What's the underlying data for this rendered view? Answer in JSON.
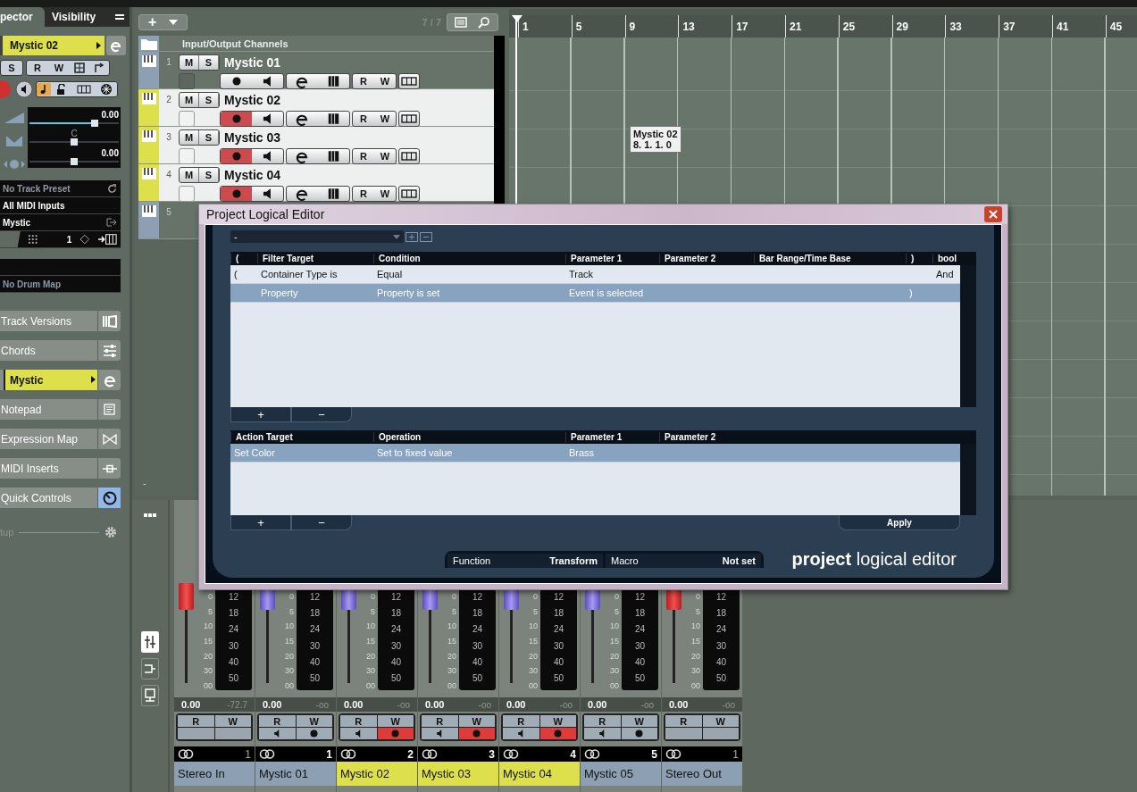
{
  "inspector": {
    "tabs": [
      {
        "label": "pector",
        "selected": true
      },
      {
        "label": "Visibility",
        "selected": false
      }
    ],
    "track_name": "Mystic 02",
    "solo": "S",
    "read": "R",
    "write": "W",
    "sliders": [
      {
        "kind": "volume",
        "reading": "0.00",
        "level": 0.73
      },
      {
        "kind": "pan",
        "reading": "C",
        "level": 0.5
      },
      {
        "kind": "delay",
        "reading": "0.00",
        "level": 0.5
      }
    ],
    "preset": "No Track Preset",
    "input": "All MIDI Inputs",
    "output": "Mystic",
    "channel": "1",
    "drum_map": "No Drum Map",
    "sections": [
      {
        "label": "Track Versions",
        "kind": "versions",
        "active": false
      },
      {
        "label": "Chords",
        "kind": "chords",
        "active": false
      },
      {
        "label": "Mystic",
        "kind": "instrument",
        "active": false
      },
      {
        "label": "Notepad",
        "kind": "notepad",
        "active": false
      },
      {
        "label": "Expression Map",
        "kind": "expression",
        "active": false
      },
      {
        "label": "MIDI Inserts",
        "kind": "inserts",
        "active": false
      },
      {
        "label": "Quick Controls",
        "kind": "quick",
        "active": true
      }
    ],
    "setup": "tup"
  },
  "project": {
    "add_button": "+",
    "counter": "7 / 7",
    "folder": "Input/Output Channels",
    "footer": "-",
    "tracks": [
      {
        "number": "1",
        "name": "Mystic 01",
        "color": "#8d9fb3",
        "selected": false,
        "record": false,
        "mute": "M",
        "solo": "S",
        "read": "R",
        "write": "W"
      },
      {
        "number": "2",
        "name": "Mystic 02",
        "color": "#dde04a",
        "selected": true,
        "record": true,
        "mute": "M",
        "solo": "S",
        "read": "R",
        "write": "W"
      },
      {
        "number": "3",
        "name": "Mystic 03",
        "color": "#dde04a",
        "selected": true,
        "record": true,
        "mute": "M",
        "solo": "S",
        "read": "R",
        "write": "W"
      },
      {
        "number": "4",
        "name": "Mystic 04",
        "color": "#dde04a",
        "selected": true,
        "record": true,
        "mute": "M",
        "solo": "S",
        "read": "R",
        "write": "W"
      },
      {
        "number": "5",
        "color": "#8d9fb3",
        "selected": false
      }
    ],
    "bars": [
      "1",
      "5",
      "9",
      "13",
      "17",
      "21",
      "25",
      "29",
      "33",
      "37",
      "41",
      "45"
    ],
    "tooltip": {
      "name": "Mystic 02",
      "position": "8. 1. 1.  0"
    }
  },
  "mixer": {
    "channels": [
      {
        "name": "Stereo In",
        "number": "1",
        "kind": "bus",
        "color": "#8d9fb3",
        "volume": "0.00",
        "peak": "-72.7",
        "read": "R",
        "write": "W",
        "fader_scale": [
          "0",
          "5",
          "10",
          "15",
          "20",
          "30",
          "00"
        ],
        "meter_scale": [
          "12",
          "18",
          "24",
          "30",
          "40",
          "50"
        ]
      },
      {
        "name": "Mystic 01",
        "number": "1",
        "kind": "midi",
        "color": "#8d9fb3",
        "volume": "0.00",
        "peak": "-oo",
        "record": false,
        "read": "R",
        "write": "W",
        "fader_scale": [
          "0",
          "5",
          "10",
          "15",
          "20",
          "30",
          "00"
        ],
        "meter_scale": [
          "12",
          "18",
          "24",
          "30",
          "40",
          "50"
        ]
      },
      {
        "name": "Mystic 02",
        "number": "2",
        "kind": "midi",
        "color": "#dde04a",
        "volume": "0.00",
        "peak": "-oo",
        "record": true,
        "read": "R",
        "write": "W",
        "fader_scale": [
          "0",
          "5",
          "10",
          "15",
          "20",
          "30",
          "00"
        ],
        "meter_scale": [
          "12",
          "18",
          "24",
          "30",
          "40",
          "50"
        ]
      },
      {
        "name": "Mystic 03",
        "number": "3",
        "kind": "midi",
        "color": "#dde04a",
        "volume": "0.00",
        "peak": "-oo",
        "record": true,
        "read": "R",
        "write": "W",
        "fader_scale": [
          "0",
          "5",
          "10",
          "15",
          "20",
          "30",
          "00"
        ],
        "meter_scale": [
          "12",
          "18",
          "24",
          "30",
          "40",
          "50"
        ]
      },
      {
        "name": "Mystic 04",
        "number": "4",
        "kind": "midi",
        "color": "#dde04a",
        "volume": "0.00",
        "peak": "-oo",
        "record": true,
        "read": "R",
        "write": "W",
        "fader_scale": [
          "0",
          "5",
          "10",
          "15",
          "20",
          "30",
          "00"
        ],
        "meter_scale": [
          "12",
          "18",
          "24",
          "30",
          "40",
          "50"
        ]
      },
      {
        "name": "Mystic 05",
        "number": "5",
        "kind": "midi",
        "color": "#8d9fb3",
        "volume": "0.00",
        "peak": "-oo",
        "record": false,
        "read": "R",
        "write": "W",
        "fader_scale": [
          "0",
          "5",
          "10",
          "15",
          "20",
          "30",
          "00"
        ],
        "meter_scale": [
          "12",
          "18",
          "24",
          "30",
          "40",
          "50"
        ]
      },
      {
        "name": "Stereo Out",
        "number": "1",
        "kind": "bus",
        "color": "#8d9fb3",
        "volume": "0.00",
        "peak": "-oo",
        "read": "R",
        "write": "W",
        "fader_scale": [
          "0",
          "5",
          "10",
          "15",
          "20",
          "30",
          "00"
        ],
        "meter_scale": [
          "12",
          "18",
          "24",
          "30",
          "40",
          "50"
        ]
      }
    ]
  },
  "dialog": {
    "title": "Project Logical Editor",
    "preset": "-",
    "filter_columns": [
      "(",
      "Filter Target",
      "Condition",
      "Parameter 1",
      "Parameter 2",
      "Bar Range/Time Base",
      ")",
      "bool"
    ],
    "filter_rows": [
      {
        "bracket_open": "(",
        "target": "Container Type is",
        "condition": "Equal",
        "parameter_1": "Track",
        "bool": "And",
        "selected": false
      },
      {
        "target": "Property",
        "condition": "Property is set",
        "parameter_1": "Event is selected",
        "bracket_close": ")",
        "selected": true
      }
    ],
    "filter_buttons": [
      "+",
      "−"
    ],
    "action_columns": [
      "Action Target",
      "Operation",
      "Parameter 1",
      "Parameter 2"
    ],
    "action_rows": [
      {
        "target": "Set Color",
        "operation": "Set to fixed value",
        "parameter_1": "Brass",
        "selected": true
      }
    ],
    "action_buttons": [
      "+",
      "−"
    ],
    "apply": "Apply",
    "function": {
      "label": "Function",
      "value": "Transform"
    },
    "macro": {
      "label": "Macro",
      "value": "Not set"
    },
    "logo": "**project** logical editor"
  }
}
